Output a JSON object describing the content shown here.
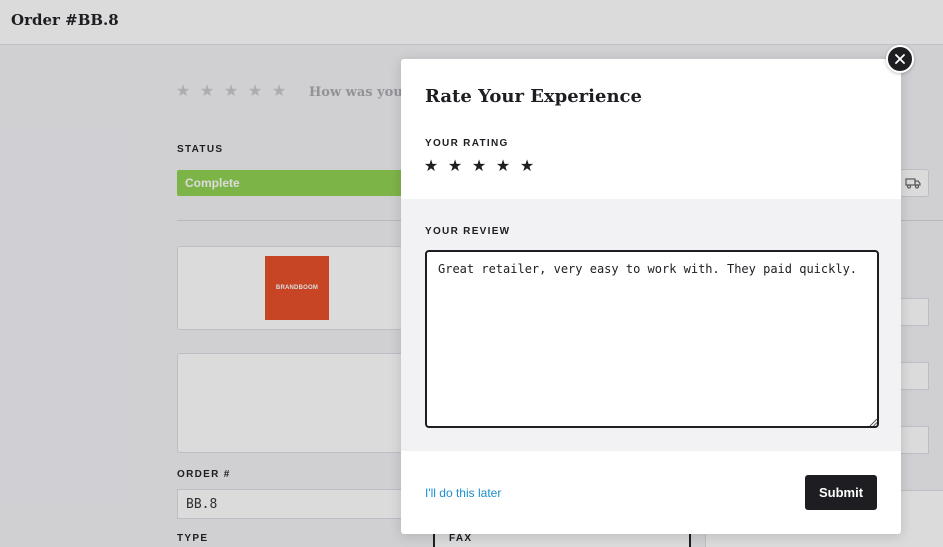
{
  "page": {
    "title": "Order #BB.8",
    "rating_prompt": "How was your ",
    "status_label": "STATUS",
    "status_value": "Complete",
    "logo_text": "BRANDBOOM",
    "order_label": "ORDER #",
    "order_value": "BB.8",
    "type_label": "TYPE",
    "fax_label": "FAX"
  },
  "modal": {
    "title": "Rate Your Experience",
    "rating_label": "YOUR RATING",
    "rating": 5,
    "rating_max": 5,
    "review_label": "YOUR REVIEW",
    "review_text": "Great retailer, very easy to work with. They paid quickly. ",
    "later_label": "I'll do this later",
    "submit_label": "Submit"
  },
  "icons": {
    "close": "close-icon",
    "star": "star-icon",
    "truck": "truck-icon"
  },
  "colors": {
    "status_complete": "#8fd14f",
    "accent_link": "#1a8fce",
    "primary_dark": "#1d1d22",
    "brand_logo": "#e74c26"
  }
}
